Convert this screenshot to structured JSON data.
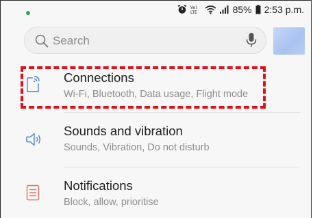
{
  "status_bar": {
    "battery_text": "85%",
    "time": "2:53 p.m.",
    "volte_label": "Vo)) LTE",
    "notification_dot_color": "#2eae54"
  },
  "search": {
    "placeholder": "Search"
  },
  "settings": {
    "items": [
      {
        "title": "Connections",
        "subtitle": "Wi-Fi, Bluetooth, Data usage, Flight mode",
        "icon": "connections-icon"
      },
      {
        "title": "Sounds and vibration",
        "subtitle": "Sounds, Vibration, Do not disturb",
        "icon": "sound-icon"
      },
      {
        "title": "Notifications",
        "subtitle": "Block, allow, prioritise",
        "icon": "notifications-icon"
      }
    ]
  },
  "colors": {
    "highlight": "#e3101a",
    "icon_blue": "#4a7fd8",
    "icon_red": "#e06c5a"
  }
}
